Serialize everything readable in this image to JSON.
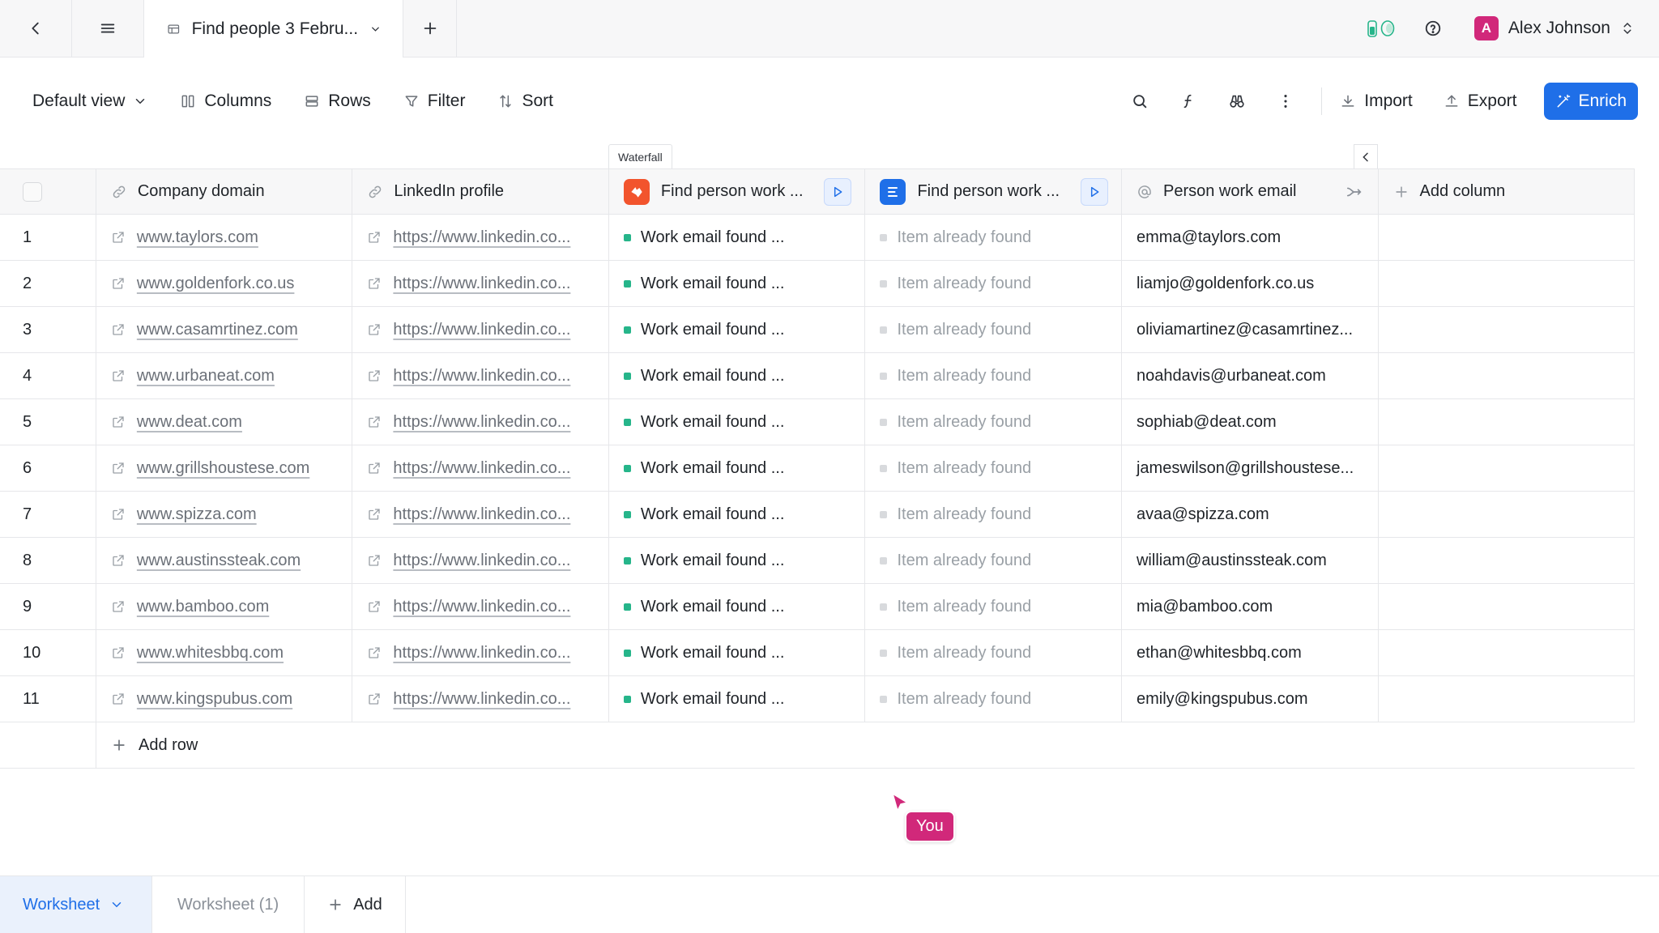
{
  "topbar": {
    "tab_title": "Find people 3 Febru...",
    "user_initial": "A",
    "user_name": "Alex Johnson"
  },
  "toolbar": {
    "view": "Default view",
    "columns": "Columns",
    "rows": "Rows",
    "filter": "Filter",
    "sort": "Sort",
    "import": "Import",
    "export": "Export",
    "enrich": "Enrich"
  },
  "waterfall_label": "Waterfall",
  "columns": {
    "company_domain": "Company domain",
    "linkedin": "LinkedIn profile",
    "find_work_1": "Find person work ...",
    "find_work_2": "Find person work ...",
    "work_email": "Person work email",
    "add_column": "Add column"
  },
  "colors": {
    "accent": "#1f6fe8",
    "found_dot": "#26b58a",
    "already_dot": "#d8dadd",
    "provider1": "#f2542d",
    "provider2": "#1f6fe8",
    "cursor": "#d1287a"
  },
  "rows": [
    {
      "n": "1",
      "domain": "www.taylors.com",
      "linkedin": "https://www.linkedin.co...",
      "status1": "Work email found ...",
      "status2": "Item already found",
      "email": "emma@taylors.com"
    },
    {
      "n": "2",
      "domain": "www.goldenfork.co.us",
      "linkedin": "https://www.linkedin.co...",
      "status1": "Work email found ...",
      "status2": "Item already found",
      "email": "liamjo@goldenfork.co.us"
    },
    {
      "n": "3",
      "domain": "www.casamrtinez.com",
      "linkedin": "https://www.linkedin.co...",
      "status1": "Work email found ...",
      "status2": "Item already found",
      "email": "oliviamartinez@casamrtinez..."
    },
    {
      "n": "4",
      "domain": "www.urbaneat.com",
      "linkedin": "https://www.linkedin.co...",
      "status1": "Work email found ...",
      "status2": "Item already found",
      "email": "noahdavis@urbaneat.com"
    },
    {
      "n": "5",
      "domain": "www.deat.com",
      "linkedin": "https://www.linkedin.co...",
      "status1": "Work email found ...",
      "status2": "Item already found",
      "email": "sophiab@deat.com"
    },
    {
      "n": "6",
      "domain": "www.grillshoustese.com",
      "linkedin": "https://www.linkedin.co...",
      "status1": "Work email found ...",
      "status2": "Item already found",
      "email": "jameswilson@grillshoustese..."
    },
    {
      "n": "7",
      "domain": "www.spizza.com",
      "linkedin": "https://www.linkedin.co...",
      "status1": "Work email found ...",
      "status2": "Item already found",
      "email": "avaa@spizza.com"
    },
    {
      "n": "8",
      "domain": "www.austinssteak.com",
      "linkedin": "https://www.linkedin.co...",
      "status1": "Work email found ...",
      "status2": "Item already found",
      "email": "william@austinssteak.com"
    },
    {
      "n": "9",
      "domain": "www.bamboo.com",
      "linkedin": "https://www.linkedin.co...",
      "status1": "Work email found ...",
      "status2": "Item already found",
      "email": "mia@bamboo.com"
    },
    {
      "n": "10",
      "domain": "www.whitesbbq.com",
      "linkedin": "https://www.linkedin.co...",
      "status1": "Work email found ...",
      "status2": "Item already found",
      "email": "ethan@whitesbbq.com"
    },
    {
      "n": "11",
      "domain": "www.kingspubus.com",
      "linkedin": "https://www.linkedin.co...",
      "status1": "Work email found ...",
      "status2": "Item already found",
      "email": "emily@kingspubus.com"
    }
  ],
  "add_row": "Add row",
  "cursor_label": "You",
  "sheets": {
    "active": "Worksheet",
    "other": "Worksheet (1)",
    "add": "Add"
  }
}
